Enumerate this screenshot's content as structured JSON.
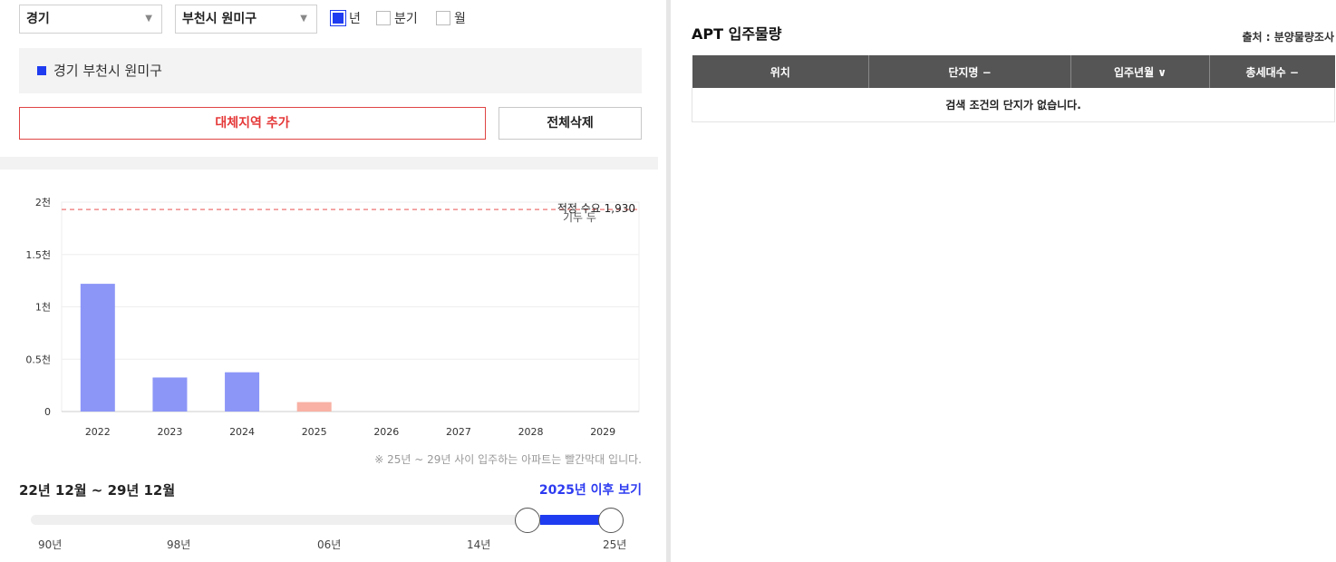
{
  "filters": {
    "province": "경기",
    "district": "부천시 원미구",
    "period_options": [
      {
        "label": "년",
        "checked": true
      },
      {
        "label": "분기",
        "checked": false
      },
      {
        "label": "월",
        "checked": false
      }
    ]
  },
  "selected_region": "경기 부천시 원미구",
  "buttons": {
    "add_region": "대체지역 추가",
    "clear_all": "전체삭제"
  },
  "chart_data": {
    "type": "bar",
    "categories": [
      "2022",
      "2023",
      "2024",
      "2025",
      "2026",
      "2027",
      "2028",
      "2029"
    ],
    "values": [
      1220,
      325,
      375,
      90,
      0,
      0,
      0,
      0
    ],
    "bar_colors": [
      "#8c96f7",
      "#8c96f7",
      "#8c96f7",
      "#f8b1a4",
      "#8c96f7",
      "#8c96f7",
      "#8c96f7",
      "#8c96f7"
    ],
    "ylim": [
      0,
      2000
    ],
    "y_ticks": [
      {
        "value": 0,
        "label": "0"
      },
      {
        "value": 500,
        "label": "0.5천"
      },
      {
        "value": 1000,
        "label": "1천"
      },
      {
        "value": 1500,
        "label": "1.5천"
      },
      {
        "value": 2000,
        "label": "2천"
      }
    ],
    "reference_line": {
      "value": 1930,
      "label": "적정 수요 1,930",
      "color": "#f08a8a"
    },
    "overlay_text": "기두 두",
    "grid": true
  },
  "note": "※ 25년 ~ 29년 사이 입주하는 아파트는 빨간막대 입니다.",
  "range": {
    "label": "22년 12월 ~ 29년 12월",
    "after_link": "2025년 이후 보기",
    "slider_labels": [
      "90년",
      "98년",
      "06년",
      "14년",
      "25년"
    ],
    "selected_start_pct": 86,
    "selected_end_pct": 100
  },
  "apt": {
    "title": "APT 입주물량",
    "source": "출처 : 분양물량조사",
    "columns": [
      "위치",
      "단지명 −",
      "입주년월 ∨",
      "총세대수 −"
    ],
    "empty_message": "검색 조건의 단지가 없습니다."
  },
  "colors": {
    "accent_blue": "#1f3cf0",
    "accent_red": "#e53838",
    "table_header": "#555555"
  }
}
